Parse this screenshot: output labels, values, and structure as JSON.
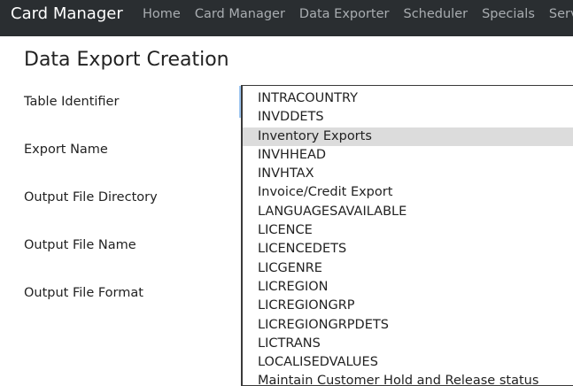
{
  "navbar": {
    "brand": "Card Manager",
    "links": [
      "Home",
      "Card Manager",
      "Data Exporter",
      "Scheduler",
      "Specials",
      "Server"
    ]
  },
  "page": {
    "title": "Data Export Creation"
  },
  "form": {
    "table_identifier_label": "Table Identifier",
    "export_name_label": "Export Name",
    "output_directory_label": "Output File Directory",
    "output_file_name_label": "Output File Name",
    "output_file_format_label": "Output File Format"
  },
  "dropdown": {
    "selected": "Inventory Exports",
    "options": [
      "INTRACOUNTRY",
      "INVDDETS",
      "Inventory Exports",
      "INVHHEAD",
      "INVHTAX",
      "Invoice/Credit Export",
      "LANGUAGESAVAILABLE",
      "LICENCE",
      "LICENCEDETS",
      "LICGENRE",
      "LICREGION",
      "LICREGIONGRP",
      "LICREGIONGRPDETS",
      "LICTRANS",
      "LOCALISEDVALUES",
      "Maintain Customer Hold and Release status"
    ]
  }
}
